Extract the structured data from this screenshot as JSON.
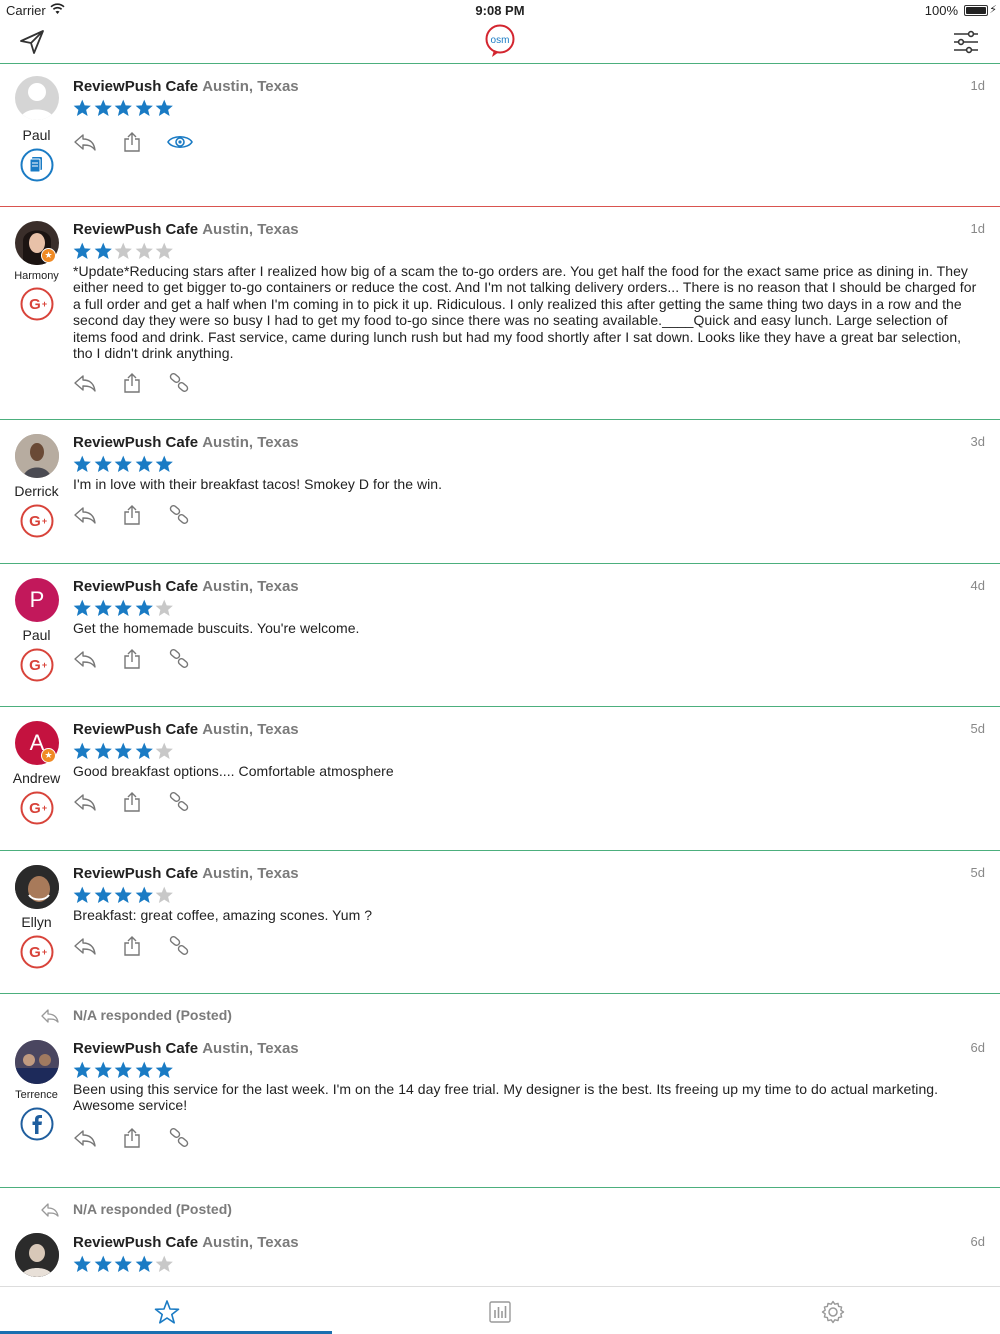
{
  "status_bar": {
    "carrier": "Carrier",
    "time": "9:08 PM",
    "battery": "100%"
  },
  "nav": {
    "logo_text": "osm",
    "brand_color": "#d3252f",
    "accent_color": "#1a7bc4",
    "divider_color": "#4caf7d"
  },
  "reviews": [
    {
      "business": "ReviewPush Cafe",
      "location": "Austin, Texas",
      "author": "Paul",
      "age": "1d",
      "rating": 5,
      "text": "",
      "source_icon": "document-source-icon",
      "third_action": "eye-icon",
      "avatar_type": "placeholder-avatar"
    },
    {
      "business": "ReviewPush Cafe",
      "location": "Austin, Texas",
      "author": "Harmony",
      "age": "1d",
      "rating": 2,
      "text": "*Update*Reducing stars after I realized how big of a scam the to-go orders are. You get half the food for the exact same price as dining in.  They either need to get bigger to-go containers or reduce the cost. And I'm not talking delivery orders... There is no reason that I should be charged for a full order and get a half when I'm coming in to pick it up. Ridiculous. I only realized this after getting the same thing two days in a row and the second day they were so busy I had to get my food to-go since there was no seating available.____Quick and easy lunch. Large selection of items food and drink. Fast service, came during lunch rush but had my food shortly after I sat down. Looks like they have a great bar selection, tho I didn't drink anything.",
      "source_icon": "google-plus-icon",
      "third_action": "link-icon"
    },
    {
      "business": "ReviewPush Cafe",
      "location": "Austin, Texas",
      "author": "Derrick",
      "age": "3d",
      "rating": 5,
      "text": "I'm in love with their breakfast tacos! Smokey D for the win.",
      "source_icon": "google-plus-icon",
      "third_action": "link-icon"
    },
    {
      "business": "ReviewPush Cafe",
      "location": "Austin, Texas",
      "author": "Paul",
      "age": "4d",
      "rating": 4,
      "text": "Get the homemade buscuits. You're welcome.",
      "source_icon": "google-plus-icon",
      "third_action": "link-icon",
      "avatar_letter": "P"
    },
    {
      "business": "ReviewPush Cafe",
      "location": "Austin, Texas",
      "author": "Andrew",
      "age": "5d",
      "rating": 4,
      "text": "Good breakfast options....  Comfortable atmosphere",
      "source_icon": "google-plus-icon",
      "third_action": "link-icon",
      "avatar_letter": "A"
    },
    {
      "business": "ReviewPush Cafe",
      "location": "Austin, Texas",
      "author": "Ellyn",
      "age": "5d",
      "rating": 4,
      "text": "Breakfast: great coffee, amazing scones. Yum ?",
      "source_icon": "google-plus-icon",
      "third_action": "link-icon"
    },
    {
      "business": "ReviewPush Cafe",
      "location": "Austin, Texas",
      "author": "Terrence",
      "age": "6d",
      "rating": 5,
      "text": "Been using this service for the last week.  I'm on the 14 day free trial.  My designer is the best.  Its freeing up my time to do actual marketing.  Awesome service!",
      "responded": "N/A responded (Posted)",
      "source_icon": "facebook-icon",
      "third_action": "link-icon"
    },
    {
      "business": "ReviewPush Cafe",
      "location": "Austin, Texas",
      "author": "",
      "age": "6d",
      "rating": 4,
      "text": "",
      "responded": "N/A responded (Posted)"
    }
  ],
  "tabs": [
    {
      "name": "reviews-tab",
      "icon": "star-icon",
      "active": true
    },
    {
      "name": "reports-tab",
      "icon": "bar-chart-icon",
      "active": false
    },
    {
      "name": "settings-tab",
      "icon": "gear-icon",
      "active": false
    }
  ],
  "colors": {
    "star_filled": "#1a7bc4",
    "star_empty": "#c8c8c8",
    "google_red": "#d8433a",
    "facebook_blue": "#1f5e9e",
    "avatar_magenta": "#c2185b",
    "avatar_crimson": "#c4123f"
  }
}
